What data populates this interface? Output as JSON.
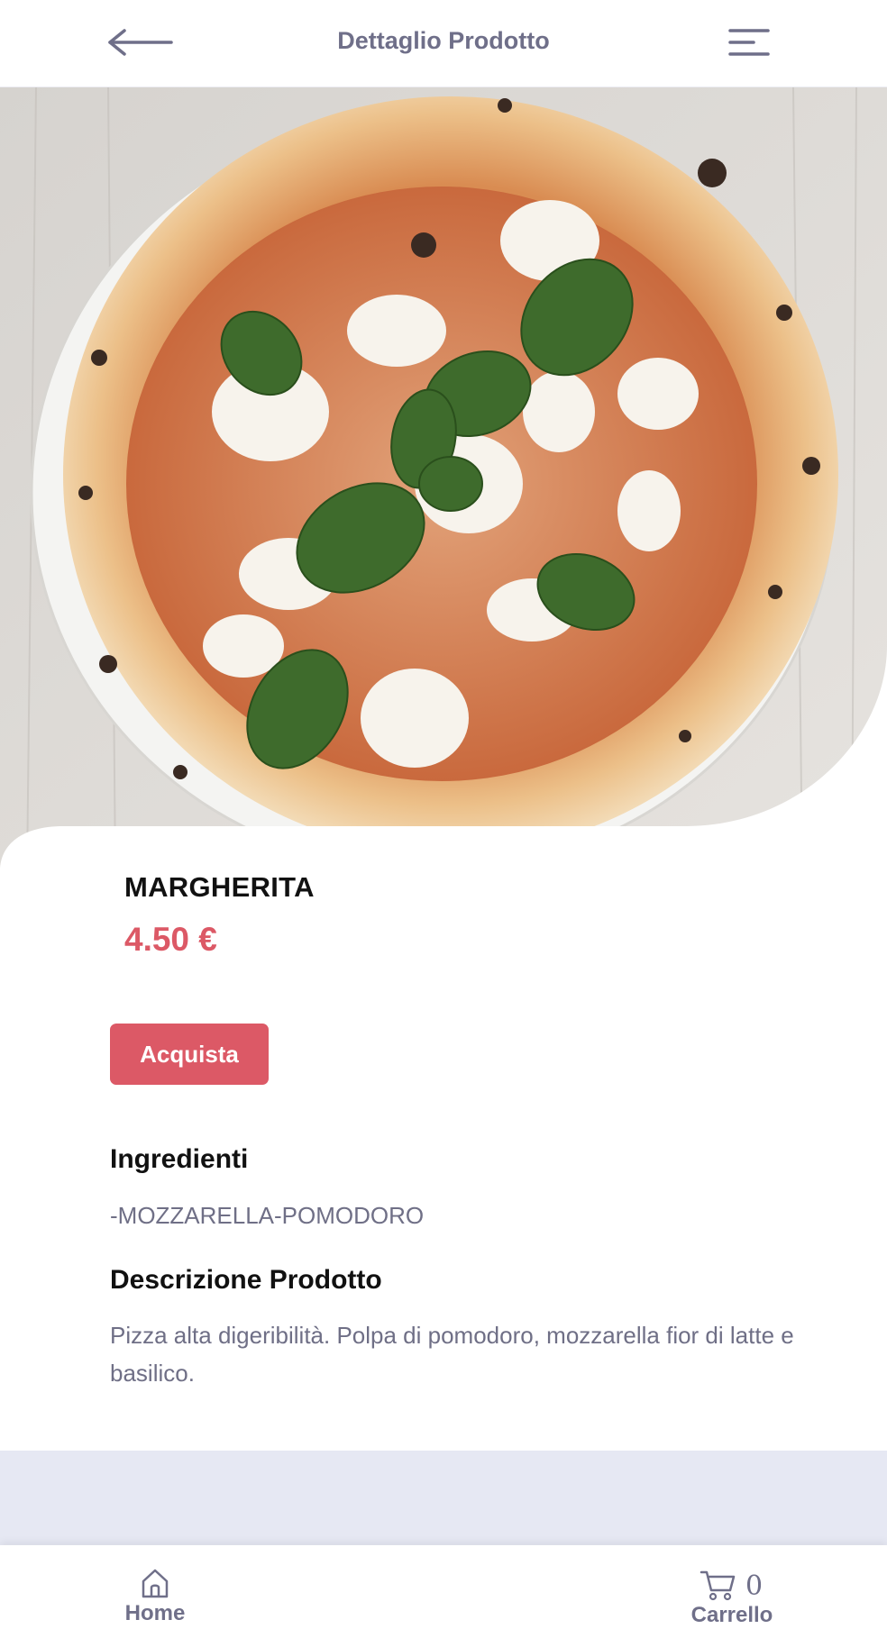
{
  "header": {
    "title": "Dettaglio Prodotto",
    "back_icon": "arrow-left-icon",
    "menu_icon": "menu-icon"
  },
  "product": {
    "name": "MARGHERITA",
    "price": "4.50 €",
    "buy_label": "Acquista",
    "image": "pizza-margherita-photo"
  },
  "ingredients": {
    "title": "Ingredienti",
    "text": "-MOZZARELLA-POMODORO"
  },
  "description": {
    "title": "Descrizione Prodotto",
    "text": "Pizza alta digeribilità. Polpa di pomodoro, mozzarella fior di latte e basilico."
  },
  "bottom_nav": {
    "home_label": "Home",
    "cart_label": "Carrello",
    "cart_count": "0"
  },
  "colors": {
    "accent": "#dc5966",
    "text_muted": "#6f6f89",
    "band": "#e6e8f3"
  }
}
